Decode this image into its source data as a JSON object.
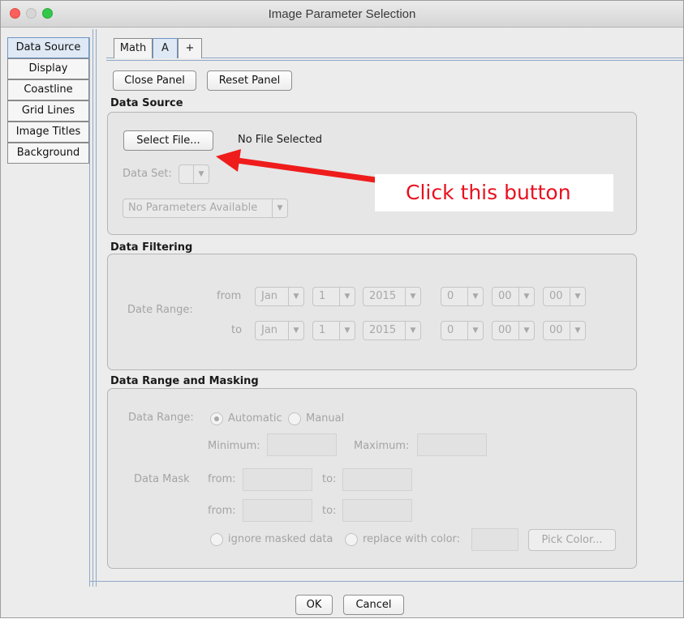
{
  "window": {
    "title": "Image Parameter Selection"
  },
  "sidebar": {
    "items": [
      {
        "label": "Data Source"
      },
      {
        "label": "Display"
      },
      {
        "label": "Coastline"
      },
      {
        "label": "Grid Lines"
      },
      {
        "label": "Image Titles"
      },
      {
        "label": "Background"
      }
    ]
  },
  "tabs": [
    {
      "label": "Math"
    },
    {
      "label": "A"
    },
    {
      "label": "+"
    }
  ],
  "panel_buttons": {
    "close": "Close Panel",
    "reset": "Reset Panel"
  },
  "data_source": {
    "title": "Data Source",
    "select_file": "Select File...",
    "file_status": "No File Selected",
    "data_set_label": "Data Set:",
    "parameters": "No Parameters Available"
  },
  "annotation": {
    "text": "Click this button",
    "color": "#e8101e"
  },
  "data_filtering": {
    "title": "Data Filtering",
    "date_range_label": "Date Range:",
    "from_label": "from",
    "to_label": "to",
    "from": {
      "month": "Jan",
      "day": "1",
      "year": "2015",
      "hour": "0",
      "minute": "00",
      "second": "00"
    },
    "to": {
      "month": "Jan",
      "day": "1",
      "year": "2015",
      "hour": "0",
      "minute": "00",
      "second": "00"
    }
  },
  "data_range": {
    "title": "Data Range and Masking",
    "range_label": "Data Range:",
    "automatic": "Automatic",
    "manual": "Manual",
    "minimum": "Minimum:",
    "maximum": "Maximum:",
    "mask_label": "Data Mask",
    "from": "from:",
    "to": "to:",
    "ignore": "ignore masked data",
    "replace": "replace with color:",
    "pick_color": "Pick Color..."
  },
  "footer": {
    "ok": "OK",
    "cancel": "Cancel"
  }
}
